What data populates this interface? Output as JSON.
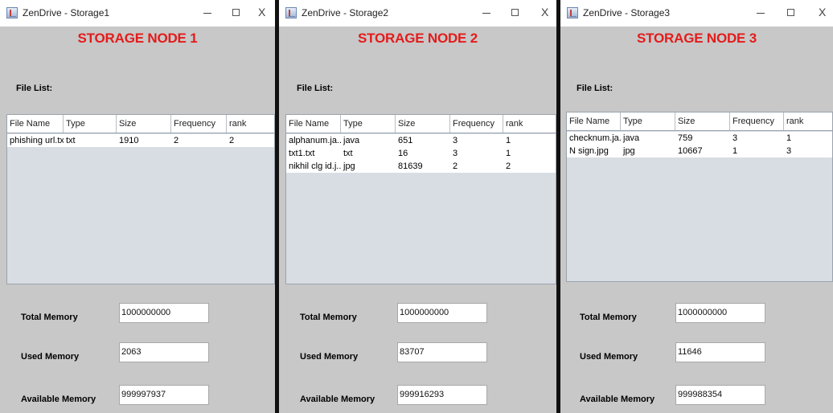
{
  "columns": [
    "File Name",
    "Type",
    "Size",
    "Frequency",
    "rank"
  ],
  "file_list_label": "File List:",
  "memory_labels": {
    "total": "Total Memory",
    "used": "Used Memory",
    "available": "Available Memory"
  },
  "windows": [
    {
      "title": "ZenDrive - Storage1",
      "node_title": "STORAGE NODE 1",
      "rows": [
        [
          "phishing url.txt",
          "txt",
          "1910",
          "2",
          "2"
        ]
      ],
      "total_memory": "1000000000",
      "used_memory": "2063",
      "available_memory": "999997937"
    },
    {
      "title": "ZenDrive - Storage2",
      "node_title": "STORAGE NODE 2",
      "rows": [
        [
          "alphanum.ja...",
          "java",
          "651",
          "3",
          "1"
        ],
        [
          "txt1.txt",
          "txt",
          "16",
          "3",
          "1"
        ],
        [
          "nikhil clg id.j...",
          "jpg",
          "81639",
          "2",
          "2"
        ]
      ],
      "total_memory": "1000000000",
      "used_memory": "83707",
      "available_memory": "999916293"
    },
    {
      "title": "ZenDrive - Storage3",
      "node_title": "STORAGE NODE 3",
      "rows": [
        [
          "checknum.ja...",
          "java",
          "759",
          "3",
          "1"
        ],
        [
          "N sign.jpg",
          "jpg",
          "10667",
          "1",
          "3"
        ]
      ],
      "total_memory": "1000000000",
      "used_memory": "11646",
      "available_memory": "999988354"
    }
  ],
  "window_controls": {
    "minimize": "—",
    "maximize": "☐",
    "close": "X"
  }
}
